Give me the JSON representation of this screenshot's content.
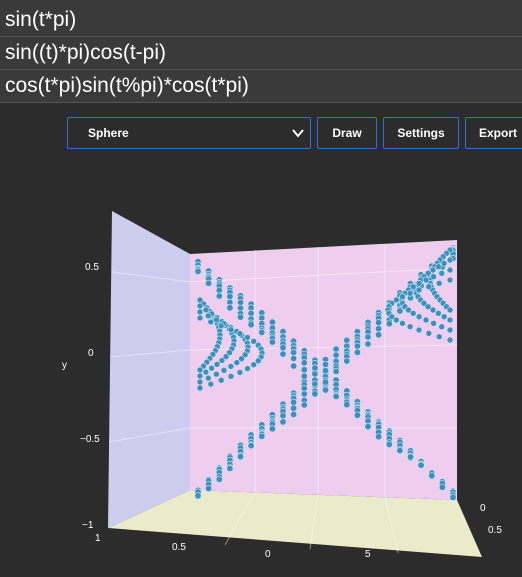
{
  "formulas": [
    "sin(t*pi)",
    "sin((t)*pi)cos(t-pi)",
    "cos(t*pi)sin(t%pi)*cos(t*pi)"
  ],
  "shape_select": {
    "value": "Sphere"
  },
  "buttons": {
    "draw": "Draw",
    "settings": "Settings",
    "export": "Export"
  },
  "plot": {
    "y_axis": {
      "label": "y",
      "ticks": [
        "0.5",
        "0",
        "−0.5",
        "−1"
      ]
    },
    "z_ticks": [
      "1",
      "0.5",
      "0",
      "5"
    ],
    "x_ticks": [
      "0",
      "0.5"
    ],
    "colors": {
      "back_wall": "#efcdee",
      "left_wall": "#cdcdf0",
      "floor": "#e9ebca",
      "points": "#3f8fbc"
    }
  }
}
